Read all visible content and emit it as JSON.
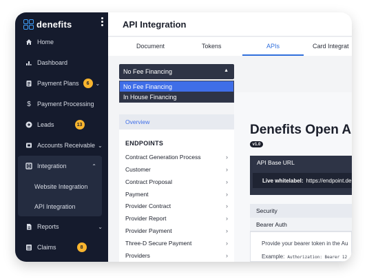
{
  "brand": {
    "name": "denefits",
    "logo_icon": "denefits-logo-icon"
  },
  "sidebar": {
    "items": [
      {
        "label": "Home",
        "icon": "home-icon"
      },
      {
        "label": "Dashboard",
        "icon": "bar-chart-icon"
      },
      {
        "label": "Payment Plans",
        "icon": "clipboard-icon",
        "badge": "6"
      },
      {
        "label": "Payment Processing",
        "icon": "dollar-icon"
      },
      {
        "label": "Leads",
        "icon": "arrow-circle-icon",
        "badge": "13"
      },
      {
        "label": "Accounts Receivable",
        "icon": "ledger-icon"
      },
      {
        "label": "Integration",
        "icon": "integration-icon"
      },
      {
        "label": "Reports",
        "icon": "document-icon"
      },
      {
        "label": "Claims",
        "icon": "list-icon",
        "badge": "8"
      }
    ],
    "integration_sub": [
      "Website Integration",
      "API Integration"
    ]
  },
  "header": {
    "title": "API Integration"
  },
  "tabs": [
    "Document",
    "Tokens",
    "APIs",
    "Card Integrat"
  ],
  "active_tab": "APIs",
  "financing_select": {
    "value": "No Fee Financing",
    "options": [
      "No Fee Financing",
      "In House Financing"
    ]
  },
  "left_panel": {
    "overview": "Overview",
    "heading": "ENDPOINTS",
    "items": [
      "Contract Generation Process",
      "Customer",
      "Contract Proposal",
      "Payment",
      "Provider Contract",
      "Provider Report",
      "Provider Payment",
      "Three-D Secure Payment",
      "Providers"
    ]
  },
  "doc": {
    "title": "Denefits Open A",
    "version": "v1.0",
    "base_url_title": "API Base URL",
    "whitelabel_label": "Live whitelabel:",
    "whitelabel_url": "https://endpoint.de",
    "security_title": "Security",
    "auth_type": "Bearer Auth",
    "auth_text": "Provide your bearer token in the Au",
    "example_label": "Example:",
    "example_code": "Authorization: Bearer 12"
  },
  "colors": {
    "sidebar_bg": "#151b2d",
    "accent": "#3f6ee8",
    "badge": "#f9b52e"
  }
}
